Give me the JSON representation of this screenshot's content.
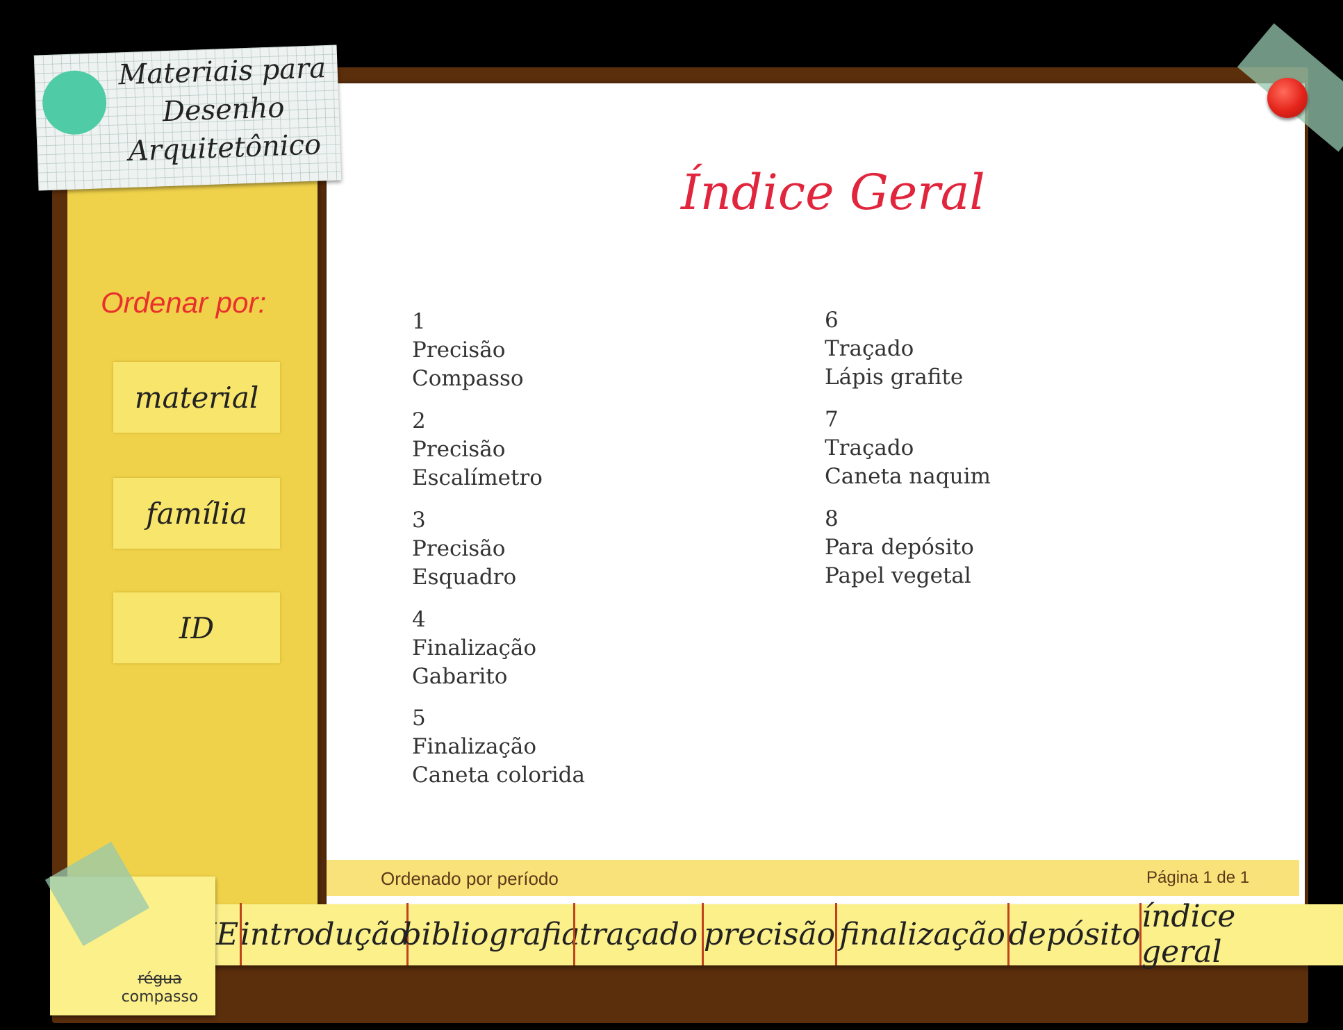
{
  "app_title": [
    "Materiais para",
    "Desenho",
    "Arquitetônico"
  ],
  "sidebar": {
    "heading": "Ordenar por:",
    "sort_buttons": [
      "material",
      "família",
      "ID"
    ]
  },
  "page_title": "Índice Geral",
  "entries": [
    {
      "id": "1",
      "family": "Precisão",
      "material": "Compasso"
    },
    {
      "id": "2",
      "family": "Precisão",
      "material": "Escalímetro"
    },
    {
      "id": "3",
      "family": "Precisão",
      "material": "Esquadro"
    },
    {
      "id": "4",
      "family": "Finalização",
      "material": "Gabarito"
    },
    {
      "id": "5",
      "family": "Finalização",
      "material": "Caneta colorida"
    },
    {
      "id": "6",
      "family": "Traçado",
      "material": "Lápis grafite"
    },
    {
      "id": "7",
      "family": "Traçado",
      "material": "Caneta naquim"
    },
    {
      "id": "8",
      "family": "Para depósito",
      "material": "Papel vegetal"
    }
  ],
  "footer": {
    "sort_status": "Ordenado por período",
    "pagination": "Página 1 de 1"
  },
  "nav": [
    "HOME",
    "introdução",
    "bibliografia",
    "traçado",
    "precisão",
    "finalização",
    "depósito",
    "índice geral"
  ],
  "sticky_note": {
    "struck": "régua",
    "text": "compasso"
  },
  "colors": {
    "accent_red": "#e0253c",
    "sidebar_yellow": "#f0d24a",
    "frame_brown": "#5b2e0c"
  }
}
